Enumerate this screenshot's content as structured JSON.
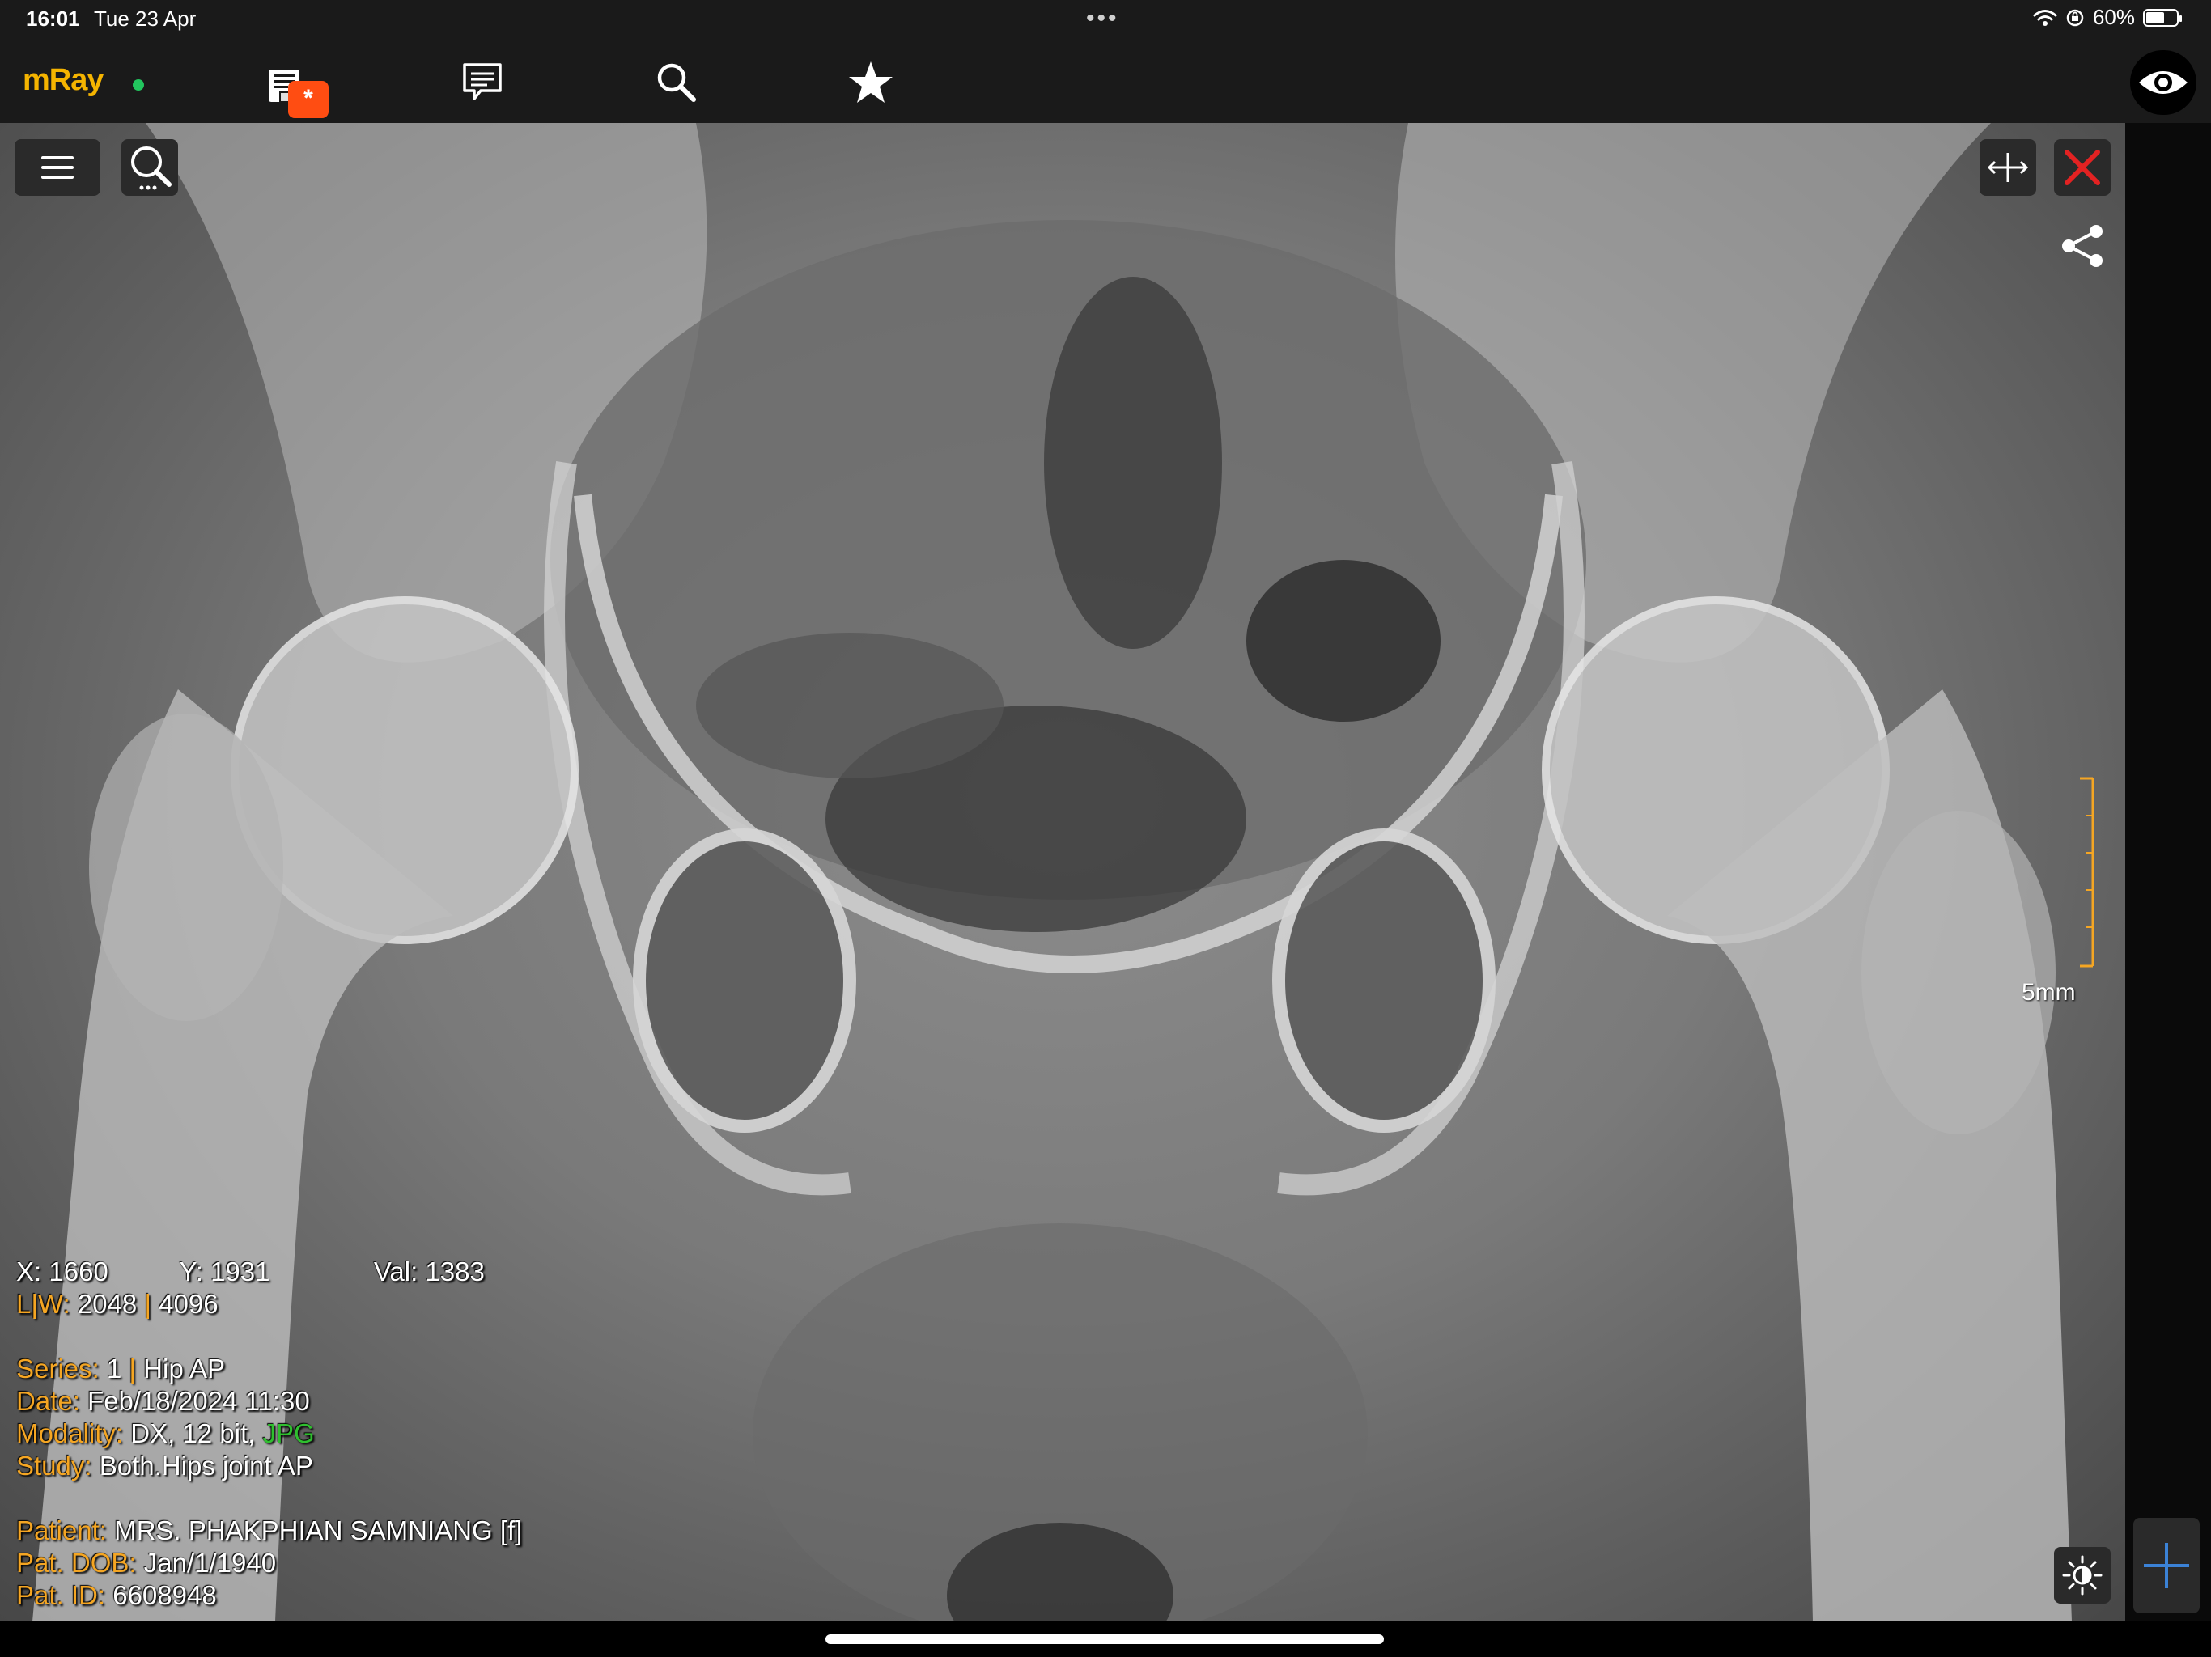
{
  "status_bar": {
    "time": "16:01",
    "date": "Tue 23 Apr",
    "battery_percent": "60%",
    "battery_level": 0.6,
    "icons": [
      "wifi-icon",
      "orientation-lock-icon",
      "battery-icon"
    ]
  },
  "toolbar": {
    "logo": "mRay",
    "badge": "*",
    "icons": [
      "studies-inbox-icon",
      "chat-icon",
      "search-icon",
      "star-icon",
      "eye-icon"
    ]
  },
  "viewer": {
    "icons": [
      "menu-icon",
      "zoom-search-icon",
      "fit-width-icon",
      "close-icon",
      "share-icon",
      "brightness-icon",
      "crosshair-icon"
    ],
    "scale_label": "5mm",
    "info": {
      "x_label": "X:",
      "x_value": "1660",
      "y_label": "Y:",
      "y_value": "1931",
      "val_label": "Val:",
      "val_value": "1383",
      "lw_label": "L|W:",
      "l_value": "2048",
      "w_value": "4096",
      "series_label": "Series:",
      "series_num": "1",
      "series_name": "Hip AP",
      "date_label": "Date:",
      "date_value": "Feb/18/2024 11:30",
      "modality_label": "Modality:",
      "modality_value": "DX, 12 bit,",
      "modality_format": "JPG",
      "study_label": "Study:",
      "study_value": "Both.Hips joint AP",
      "patient_label": "Patient:",
      "patient_value": "MRS. PHAKPHIAN SAMNIANG [f]",
      "dob_label": "Pat. DOB:",
      "dob_value": "Jan/1/1940",
      "id_label": "Pat. ID:",
      "id_value": "6608948"
    }
  },
  "colors": {
    "accent": "#f5a623",
    "logo": "#f5b400",
    "badge": "#ff4d12",
    "online_dot": "#22c55e",
    "close": "#e32222",
    "format_green": "#2fbf2f",
    "crosshair_blue": "#3b82d6"
  }
}
